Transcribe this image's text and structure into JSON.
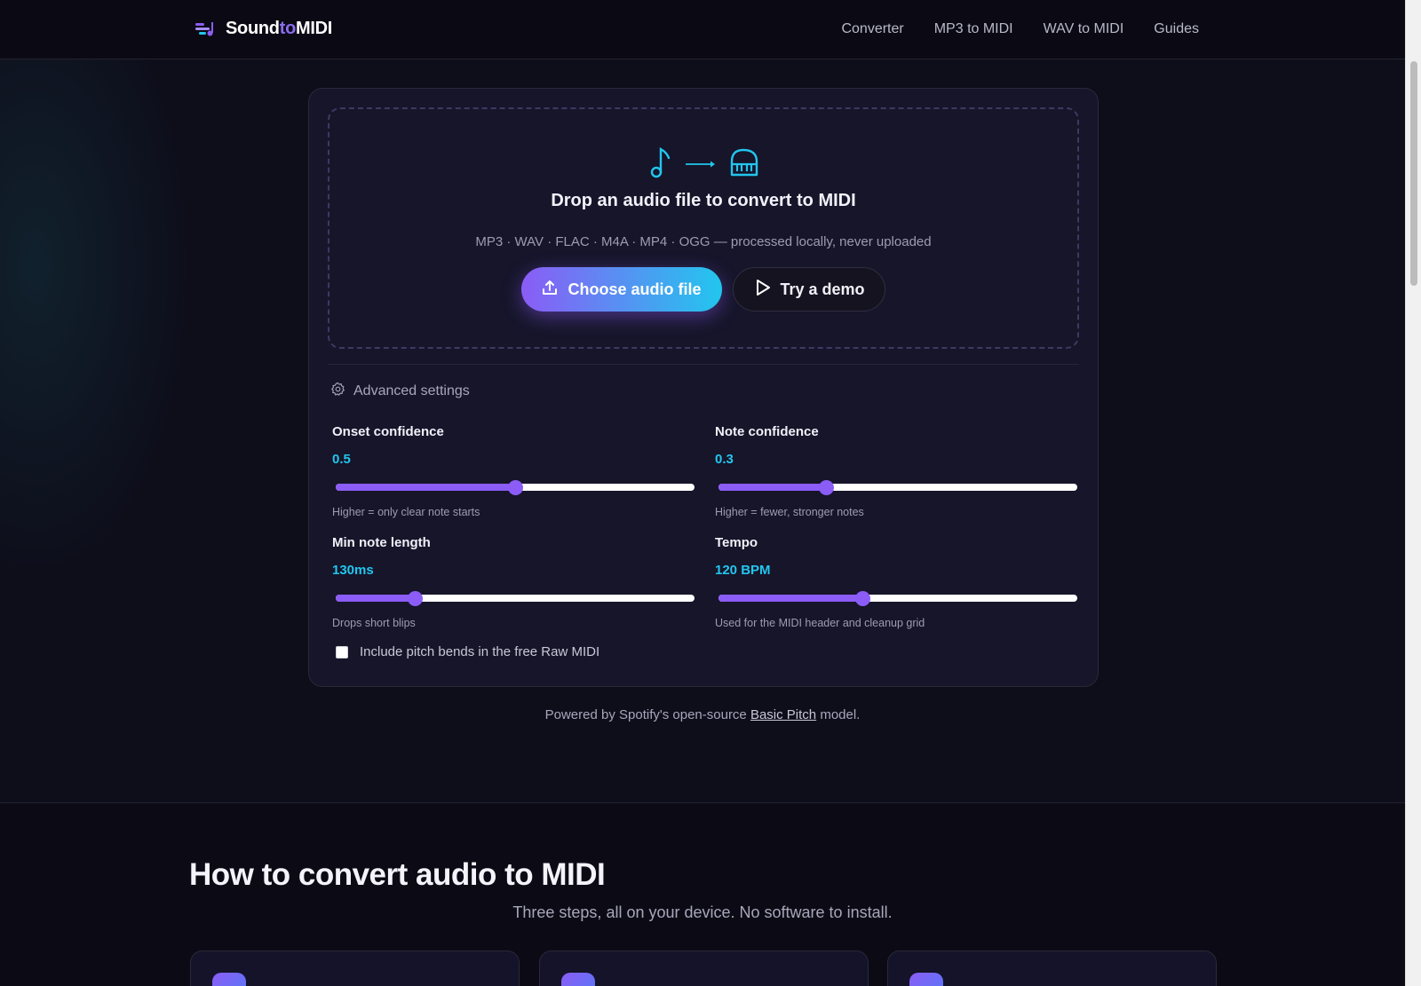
{
  "header": {
    "brand": {
      "part1": "Sound",
      "part2": "to",
      "part3": "MIDI"
    },
    "nav": [
      "Converter",
      "MP3 to MIDI",
      "WAV to MIDI",
      "Guides"
    ]
  },
  "converter": {
    "title": "Drop an audio file to convert to MIDI",
    "subtitle": "MP3 · WAV · FLAC · M4A · MP4 · OGG — processed locally, never uploaded",
    "choose_label": "Choose audio file",
    "demo_label": "Try a demo",
    "advanced_label": "Advanced settings",
    "settings": {
      "onset": {
        "label": "Onset confidence",
        "value": "0.5",
        "fraction": 0.5,
        "hint": "Higher = only clear note starts"
      },
      "note": {
        "label": "Note confidence",
        "value": "0.3",
        "fraction": 0.3,
        "hint": "Higher = fewer, stronger notes"
      },
      "minlen": {
        "label": "Min note length",
        "value": "130ms",
        "fraction": 0.22,
        "hint": "Drops short blips"
      },
      "tempo": {
        "label": "Tempo",
        "value": "120 BPM",
        "fraction": 0.4,
        "hint": "Used for the MIDI header and cleanup grid"
      }
    },
    "pitch_bends_label": "Include pitch bends in the free Raw MIDI"
  },
  "powered": {
    "before": "Powered by Spotify's open-source ",
    "link": "Basic Pitch",
    "after": " model."
  },
  "how": {
    "title": "How to convert audio to MIDI",
    "subtitle": "Three steps, all on your device. No software to install."
  },
  "colors": {
    "accent_purple": "#8b5cf6",
    "accent_cyan": "#22c6ee",
    "background": "#0e0d1a",
    "card": "#16152a"
  },
  "icons": [
    "music-note-icon",
    "arrow-right-icon",
    "piano-icon",
    "upload-icon",
    "play-icon",
    "gear-icon"
  ]
}
